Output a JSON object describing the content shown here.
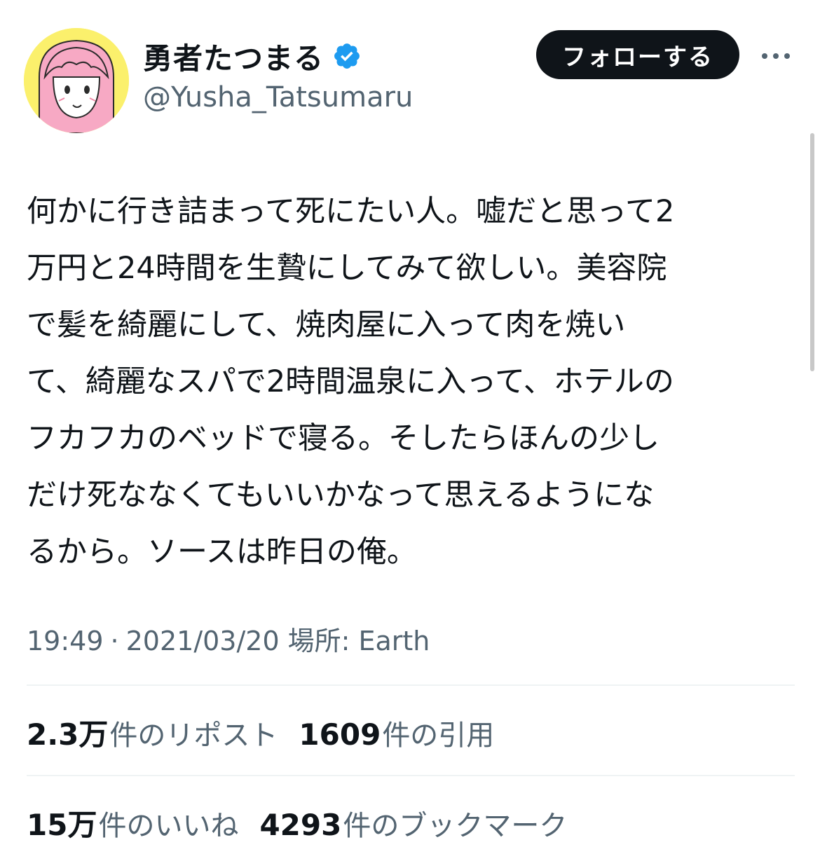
{
  "author": {
    "display_name": "勇者たつまる",
    "handle": "@Yusha_Tatsumaru"
  },
  "colors": {
    "verified": "#1d9bf0",
    "follow_bg": "#0f1419",
    "muted": "#536471",
    "avatar_bg": "#fbf06c",
    "avatar_hair": "#f7a9c4"
  },
  "follow_button": {
    "label": "フォローする"
  },
  "more_button": {
    "icon": "more-dots-icon"
  },
  "tweet": {
    "lines": [
      "何かに行き詰まって死にたい人。嘘だと思って2",
      "万円と24時間を生贄にしてみて欲しい。美容院",
      "で髪を綺麗にして、焼肉屋に入って肉を焼い",
      "て、綺麗なスパで2時間温泉に入って、ホテルの",
      "フカフカのベッドで寝る。そしたらほんの少し",
      "だけ死ななくてもいいかなって思えるようにな",
      "るから。ソースは昨日の俺。"
    ]
  },
  "meta": {
    "time": "19:49",
    "separator": "·",
    "date": "2021/03/20",
    "location_label": "場所:",
    "location_value": "Earth"
  },
  "stats": {
    "reposts": {
      "count": "2.3万",
      "label": "件のリポスト"
    },
    "quotes": {
      "count": "1609",
      "label": "件の引用"
    },
    "likes": {
      "count": "15万",
      "label": "件のいいね"
    },
    "bookmarks": {
      "count": "4293",
      "label": "件のブックマーク"
    }
  }
}
